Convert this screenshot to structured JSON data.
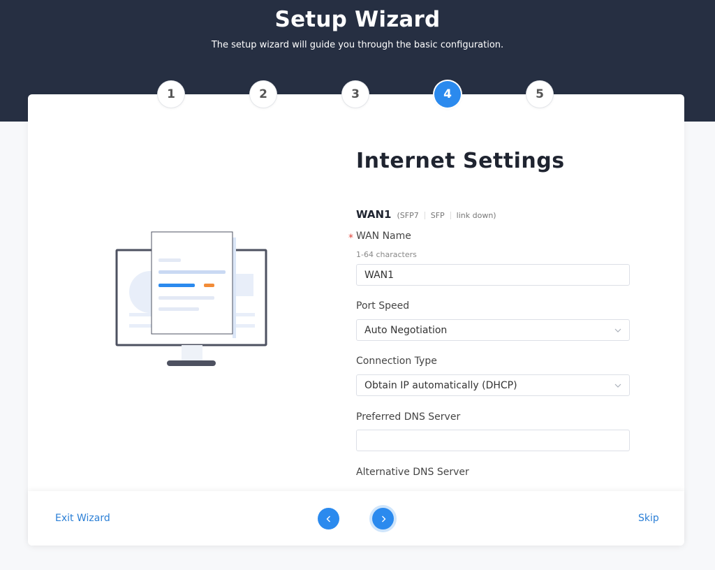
{
  "header": {
    "title": "Setup Wizard",
    "subtitle": "The setup wizard will guide you through the basic configuration."
  },
  "steps": [
    {
      "label": "1",
      "active": false
    },
    {
      "label": "2",
      "active": false
    },
    {
      "label": "3",
      "active": false
    },
    {
      "label": "4",
      "active": true
    },
    {
      "label": "5",
      "active": false
    }
  ],
  "form": {
    "title": "Internet Settings",
    "wan": {
      "name": "WAN1",
      "meta": [
        "(SFP7",
        "SFP",
        "link down)"
      ]
    },
    "wan_name": {
      "label": "WAN Name",
      "required_mark": "*",
      "hint": "1-64 characters",
      "value": "WAN1"
    },
    "port_speed": {
      "label": "Port Speed",
      "value": "Auto Negotiation"
    },
    "connection_type": {
      "label": "Connection Type",
      "value": "Obtain IP automatically (DHCP)"
    },
    "preferred_dns": {
      "label": "Preferred DNS Server",
      "value": ""
    },
    "alternative_dns": {
      "label": "Alternative DNS Server"
    }
  },
  "footer": {
    "exit_label": "Exit Wizard",
    "skip_label": "Skip"
  },
  "colors": {
    "header_bg": "#262f42",
    "accent": "#2b8aee",
    "link": "#2b7fd6",
    "required": "#e0463c"
  },
  "icons": {
    "illustration": "monitor-document-illustration",
    "prev": "chevron-left-icon",
    "next": "chevron-right-icon",
    "dropdown": "chevron-down-icon"
  }
}
